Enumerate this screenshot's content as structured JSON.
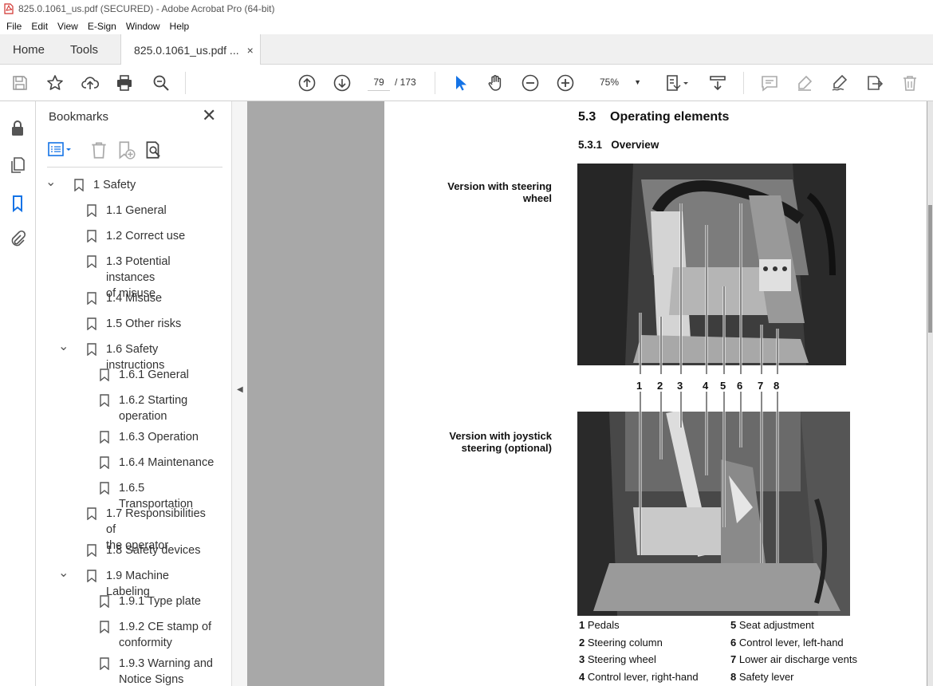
{
  "window": {
    "title": "825.0.1061_us.pdf (SECURED) - Adobe Acrobat Pro (64-bit)"
  },
  "menu": [
    "File",
    "Edit",
    "View",
    "E-Sign",
    "Window",
    "Help"
  ],
  "tabs": {
    "home": "Home",
    "tools": "Tools",
    "document": "825.0.1061_us.pdf ...",
    "close": "×"
  },
  "toolbar": {
    "page_current": "79",
    "page_total": "/ 173",
    "zoom": "75%",
    "icons": [
      "save-icon",
      "star-icon",
      "upload-icon",
      "print-icon",
      "zoom-search-icon",
      "page-up-icon",
      "page-down-icon",
      "select-arrow-icon",
      "hand-icon",
      "zoom-out-icon",
      "zoom-in-icon",
      "page-layout-icon",
      "scroll-mode-icon",
      "comment-icon",
      "highlight-icon",
      "sign-icon",
      "share-icon",
      "delete-icon"
    ]
  },
  "bookmarks": {
    "title": "Bookmarks",
    "items": [
      {
        "label": "1 Safety",
        "label2": "",
        "level": 0,
        "expanded": true
      },
      {
        "label": "1.1 General",
        "label2": "",
        "level": 1
      },
      {
        "label": "1.2 Correct use",
        "label2": "",
        "level": 1
      },
      {
        "label": "1.3 Potential instances",
        "label2": "of misuse",
        "level": 1
      },
      {
        "label": "1.4 Misuse",
        "label2": "",
        "level": 1
      },
      {
        "label": "1.5 Other risks",
        "label2": "",
        "level": 1
      },
      {
        "label": "1.6 Safety instructions",
        "label2": "",
        "level": 1,
        "expanded": true
      },
      {
        "label": "1.6.1 General",
        "label2": "",
        "level": 2
      },
      {
        "label": "1.6.2 Starting",
        "label2": "operation",
        "level": 2
      },
      {
        "label": "1.6.3 Operation",
        "label2": "",
        "level": 2
      },
      {
        "label": "1.6.4 Maintenance",
        "label2": "",
        "level": 2
      },
      {
        "label": "1.6.5 Transportation",
        "label2": "",
        "level": 2
      },
      {
        "label": "1.7 Responsibilities of",
        "label2": "the operator",
        "level": 1
      },
      {
        "label": "1.8 Safety devices",
        "label2": "",
        "level": 1
      },
      {
        "label": "1.9 Machine Labeling",
        "label2": "",
        "level": 1,
        "expanded": true
      },
      {
        "label": "1.9.1 Type plate",
        "label2": "",
        "level": 2
      },
      {
        "label": "1.9.2 CE stamp of",
        "label2": "conformity",
        "level": 2
      },
      {
        "label": "1.9.3 Warning and",
        "label2": "Notice Signs",
        "level": 2
      }
    ]
  },
  "document": {
    "section_title": "5.3    Operating elements",
    "subsection_title": "5.3.1   Overview",
    "caption1_line1": "Version with steering",
    "caption1_line2": "wheel",
    "caption2_line1": "Version with joystick",
    "caption2_line2": "steering (optional)",
    "numbers": [
      "1",
      "2",
      "3",
      "4",
      "5",
      "6",
      "7",
      "8"
    ],
    "legend": [
      {
        "num": "1",
        "text": "Pedals"
      },
      {
        "num": "2",
        "text": "Steering column"
      },
      {
        "num": "3",
        "text": "Steering wheel"
      },
      {
        "num": "4",
        "text": "Control lever, right-hand"
      },
      {
        "num": "5",
        "text": "Seat adjustment"
      },
      {
        "num": "6",
        "text": "Control lever, left-hand"
      },
      {
        "num": "7",
        "text": "Lower air discharge vents"
      },
      {
        "num": "8",
        "text": "Safety lever"
      }
    ]
  }
}
